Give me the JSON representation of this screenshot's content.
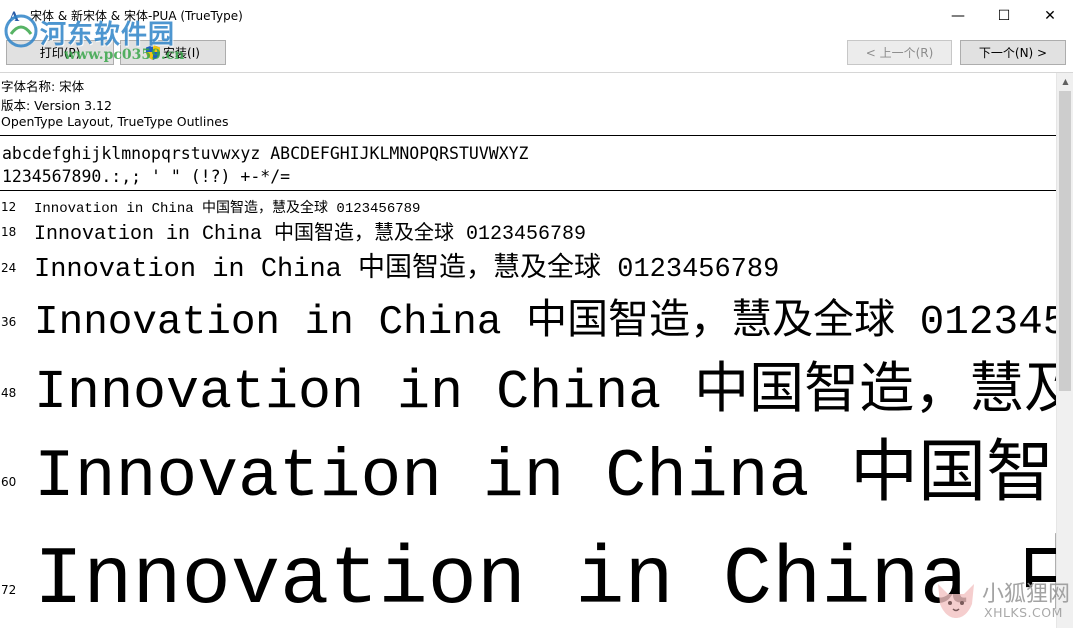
{
  "window": {
    "title": "宋体 & 新宋体 & 宋体-PUA (TrueType)",
    "minimize_glyph": "—",
    "maximize_glyph": "☐",
    "close_glyph": "✕"
  },
  "toolbar": {
    "print_label": "打印(P)",
    "install_label": "安装(I)",
    "prev_label": "< 上一个(R)",
    "next_label": "下一个(N) >"
  },
  "font_info": {
    "name_line": "字体名称: 宋体",
    "version_line": "版本: Version 3.12",
    "outlines_line": "OpenType Layout, TrueType Outlines"
  },
  "charset": {
    "letters": "abcdefghijklmnopqrstuvwxyz ABCDEFGHIJKLMNOPQRSTUVWXYZ",
    "digits_symbols": "1234567890.:,; ' \" (!?) +-*/="
  },
  "samples": {
    "text": "Innovation in China 中国智造，慧及全球 0123456789",
    "sizes": [
      "12",
      "18",
      "24",
      "36",
      "48",
      "60",
      "72"
    ]
  },
  "watermarks": {
    "top_name": "河东软件园",
    "top_url": "www.pc0359.cn",
    "bottom_name": "小狐狸网",
    "bottom_url": "XHLKS.COM"
  },
  "colors": {
    "watermark_blue": "#2f84c8",
    "watermark_green": "#39a64a",
    "button_face": "#e1e1e1",
    "disabled_text": "#8c8c8c"
  },
  "icons": {
    "app": "font-file-icon",
    "install": "uac-shield-icon",
    "scroll_up": "scroll-up-arrow-icon"
  }
}
